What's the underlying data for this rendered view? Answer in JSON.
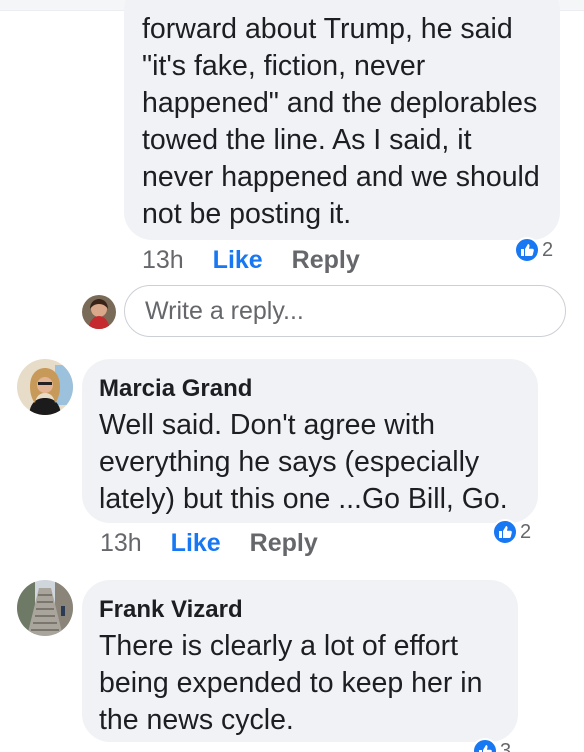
{
  "comments": [
    {
      "author": "",
      "text": "forward about Trump, he said \"it's fake, fiction, never happened\" and the deplorables towed the line. As I said, it never happened and we should not be posting it.",
      "time": "13h",
      "like_label": "Like",
      "reply_label": "Reply",
      "reaction_count": "2",
      "reaction_icon": "thumbs-up-icon"
    },
    {
      "author": "Marcia Grand",
      "text": "Well said. Don't agree with everything he says (especially lately) but this one ...Go Bill, Go.",
      "time": "13h",
      "like_label": "Like",
      "reply_label": "Reply",
      "reaction_count": "2",
      "reaction_icon": "thumbs-up-icon"
    },
    {
      "author": "Frank Vizard",
      "text": "There is clearly a lot of effort being expended to keep her in the news cycle.",
      "reaction_count": "3",
      "reaction_icon": "thumbs-up-icon"
    }
  ],
  "reply_box": {
    "placeholder": "Write a reply..."
  },
  "colors": {
    "bubble": "#f0f2f5",
    "link_blue": "#1877f2",
    "secondary_text": "#65676b",
    "primary_text": "#1c1e21"
  }
}
